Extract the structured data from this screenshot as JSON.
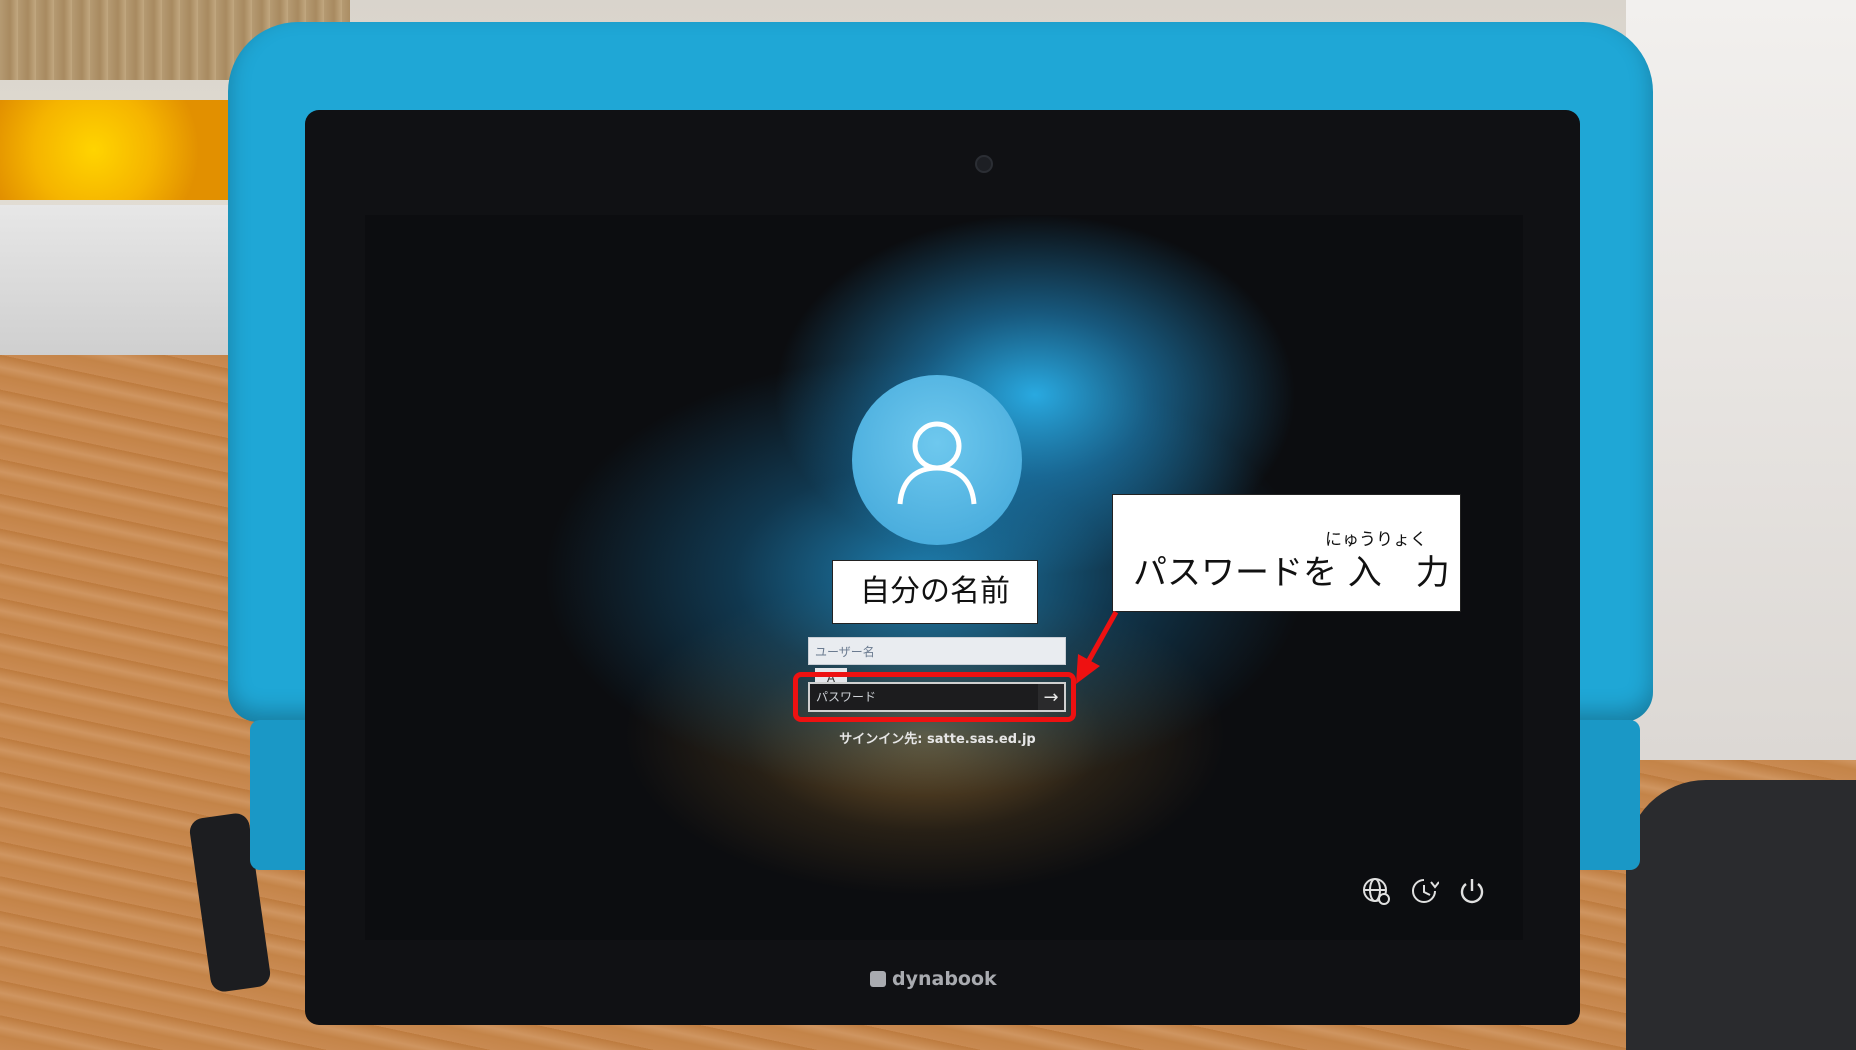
{
  "login": {
    "username_placeholder": "ユーザー名",
    "ime_indicator": "A",
    "password_placeholder": "パスワード",
    "submit_symbol": "→",
    "signin_domain": "サインイン先: satte.sas.ed.jp"
  },
  "annotations": {
    "name_callout": "自分の名前",
    "password_callout_ruby": "にゅうりょく",
    "password_callout": "パスワードを 入　力",
    "highlight_color": "#ee1111"
  },
  "system_icons": [
    "network-globe-icon",
    "ease-of-access-icon",
    "power-icon"
  ],
  "device": {
    "brand": "dynabook",
    "case_color": "#1fa7d6"
  }
}
